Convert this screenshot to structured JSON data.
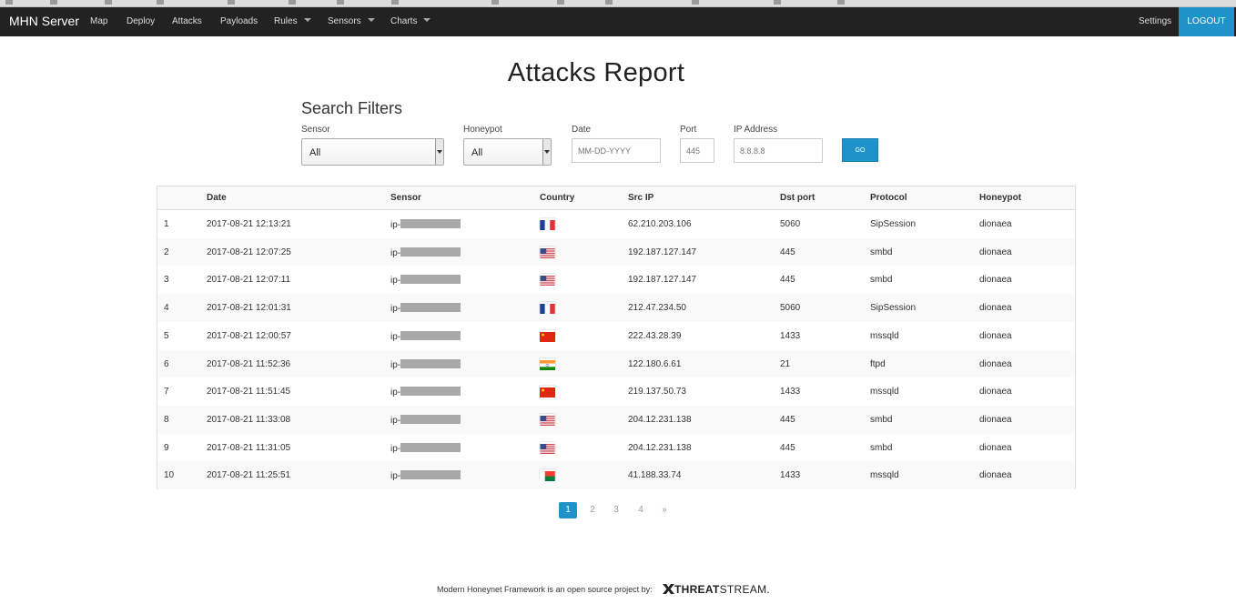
{
  "app": {
    "brand": "MHN Server"
  },
  "nav": {
    "items": [
      {
        "label": "Map",
        "dropdown": false
      },
      {
        "label": "Deploy",
        "dropdown": false
      },
      {
        "label": "Attacks",
        "dropdown": false
      },
      {
        "label": "Payloads",
        "dropdown": false
      },
      {
        "label": "Rules",
        "dropdown": true
      },
      {
        "label": "Sensors",
        "dropdown": true
      },
      {
        "label": "Charts",
        "dropdown": true
      }
    ],
    "settings": "Settings",
    "logout": "LOGOUT"
  },
  "page": {
    "title": "Attacks Report"
  },
  "filters": {
    "heading": "Search Filters",
    "sensor": {
      "label": "Sensor",
      "value": "All"
    },
    "honeypot": {
      "label": "Honeypot",
      "value": "All"
    },
    "date": {
      "label": "Date",
      "placeholder": "MM-DD-YYYY"
    },
    "port": {
      "label": "Port",
      "placeholder": "445"
    },
    "ip": {
      "label": "IP Address",
      "placeholder": "8.8.8.8"
    },
    "go": "GO"
  },
  "table": {
    "columns": [
      "Date",
      "Sensor",
      "Country",
      "Src IP",
      "Dst port",
      "Protocol",
      "Honeypot"
    ],
    "rows": [
      {
        "n": "1",
        "date": "2017-08-21 12:13:21",
        "sensor": "ip-",
        "country": "france-flag-icon",
        "src_ip": "62.210.203.106",
        "dst_port": "5060",
        "protocol": "SipSession",
        "honeypot": "dionaea"
      },
      {
        "n": "2",
        "date": "2017-08-21 12:07:25",
        "sensor": "ip-",
        "country": "usa-flag-icon",
        "src_ip": "192.187.127.147",
        "dst_port": "445",
        "protocol": "smbd",
        "honeypot": "dionaea"
      },
      {
        "n": "3",
        "date": "2017-08-21 12:07:11",
        "sensor": "ip-",
        "country": "usa-flag-icon",
        "src_ip": "192.187.127.147",
        "dst_port": "445",
        "protocol": "smbd",
        "honeypot": "dionaea"
      },
      {
        "n": "4",
        "date": "2017-08-21 12:01:31",
        "sensor": "ip-",
        "country": "france-flag-icon",
        "src_ip": "212.47.234.50",
        "dst_port": "5060",
        "protocol": "SipSession",
        "honeypot": "dionaea"
      },
      {
        "n": "5",
        "date": "2017-08-21 12:00:57",
        "sensor": "ip-",
        "country": "china-flag-icon",
        "src_ip": "222.43.28.39",
        "dst_port": "1433",
        "protocol": "mssqld",
        "honeypot": "dionaea"
      },
      {
        "n": "6",
        "date": "2017-08-21 11:52:36",
        "sensor": "ip-",
        "country": "india-flag-icon",
        "src_ip": "122.180.6.61",
        "dst_port": "21",
        "protocol": "ftpd",
        "honeypot": "dionaea"
      },
      {
        "n": "7",
        "date": "2017-08-21 11:51:45",
        "sensor": "ip-",
        "country": "china-flag-icon",
        "src_ip": "219.137.50.73",
        "dst_port": "1433",
        "protocol": "mssqld",
        "honeypot": "dionaea"
      },
      {
        "n": "8",
        "date": "2017-08-21 11:33:08",
        "sensor": "ip-",
        "country": "usa-flag-icon",
        "src_ip": "204.12.231.138",
        "dst_port": "445",
        "protocol": "smbd",
        "honeypot": "dionaea"
      },
      {
        "n": "9",
        "date": "2017-08-21 11:31:05",
        "sensor": "ip-",
        "country": "usa-flag-icon",
        "src_ip": "204.12.231.138",
        "dst_port": "445",
        "protocol": "smbd",
        "honeypot": "dionaea"
      },
      {
        "n": "10",
        "date": "2017-08-21 11:25:51",
        "sensor": "ip-",
        "country": "madagascar-flag-icon",
        "src_ip": "41.188.33.74",
        "dst_port": "1433",
        "protocol": "mssqld",
        "honeypot": "dionaea"
      }
    ]
  },
  "pagination": {
    "pages": [
      "1",
      "2",
      "3",
      "4",
      "»"
    ],
    "active": "1"
  },
  "footer": {
    "text": "Modern Honeynet Framework is an open source project by:",
    "logo_threat": "THREAT",
    "logo_stream": "STREAM."
  },
  "colors": {
    "navbar": "#222222",
    "accent": "#1f93c9"
  }
}
